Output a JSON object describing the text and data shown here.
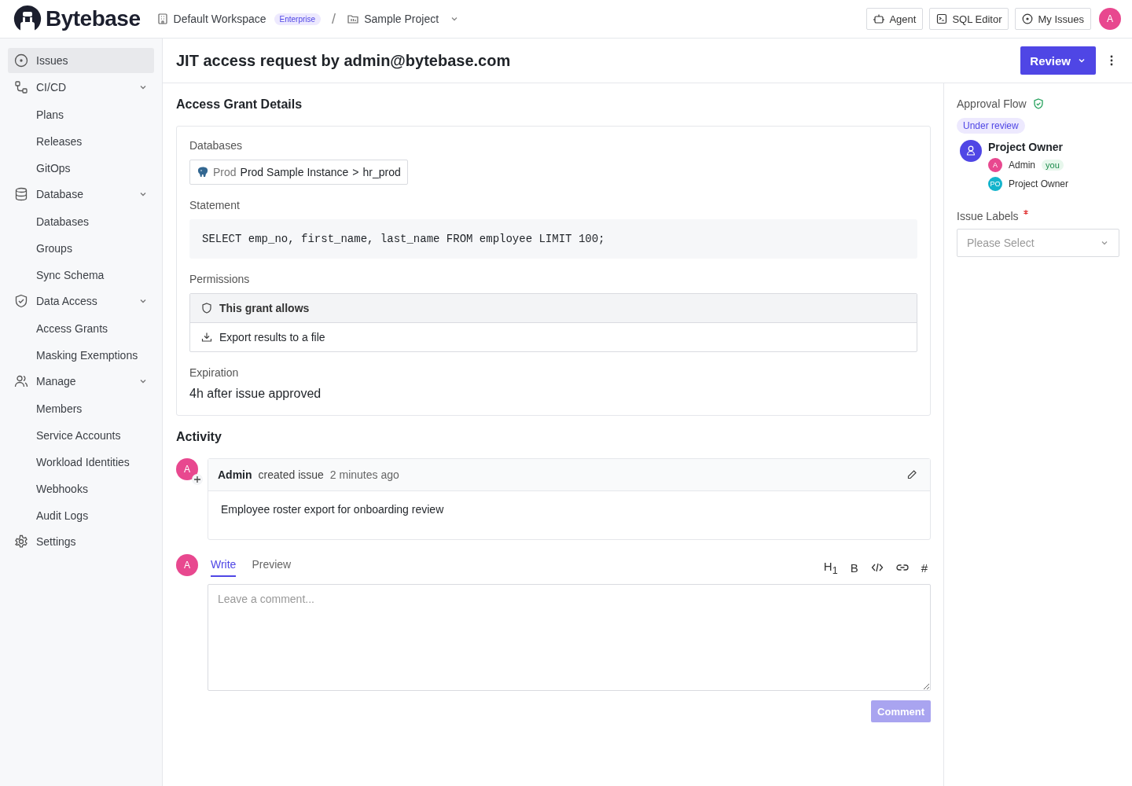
{
  "topbar": {
    "logo": "Bytebase",
    "workspace": "Default Workspace",
    "plan_badge": "Enterprise",
    "separator": "/",
    "project": "Sample Project",
    "buttons": [
      "Agent",
      "SQL Editor",
      "My Issues"
    ],
    "avatar": "A"
  },
  "sidebar": {
    "items": [
      {
        "label": "Issues",
        "selected": true
      },
      {
        "label": "CI/CD",
        "selected": false,
        "expanded": true,
        "children": [
          {
            "label": "Plans",
            "selected": false
          },
          {
            "label": "Releases",
            "selected": false
          },
          {
            "label": "GitOps",
            "selected": false
          }
        ]
      },
      {
        "label": "Database",
        "selected": false,
        "expanded": true,
        "children": [
          {
            "label": "Databases",
            "selected": false
          },
          {
            "label": "Groups",
            "selected": false
          },
          {
            "label": "Sync Schema",
            "selected": false
          }
        ]
      },
      {
        "label": "Data Access",
        "selected": false,
        "expanded": true,
        "children": [
          {
            "label": "Access Grants",
            "selected": false
          },
          {
            "label": "Masking Exemptions",
            "selected": false
          }
        ]
      },
      {
        "label": "Manage",
        "selected": false,
        "expanded": true,
        "children": [
          {
            "label": "Members",
            "selected": false
          },
          {
            "label": "Service Accounts",
            "selected": false
          },
          {
            "label": "Workload Identities",
            "selected": false
          },
          {
            "label": "Webhooks",
            "selected": false
          },
          {
            "label": "Audit Logs",
            "selected": false
          }
        ]
      },
      {
        "label": "Settings",
        "selected": false
      }
    ]
  },
  "issue": {
    "title": "JIT access request by admin@bytebase.com",
    "review_button": "Review"
  },
  "details": {
    "heading": "Access Grant Details",
    "databases_label": "Databases",
    "database": {
      "env": "Prod",
      "instance": "Prod Sample Instance",
      "separator": ">",
      "name": "hr_prod"
    },
    "statement_label": "Statement",
    "statement": "SELECT emp_no, first_name, last_name FROM employee LIMIT 100;",
    "permissions_label": "Permissions",
    "permissions_header": "This grant allows",
    "permissions": [
      "Export results to a file"
    ],
    "expiration_label": "Expiration",
    "expiration": "4h after issue approved"
  },
  "activity": {
    "heading": "Activity",
    "entries": [
      {
        "avatar": "A",
        "author": "Admin",
        "action": "created issue",
        "time": "2 minutes ago",
        "body": "Employee roster export for onboarding review"
      }
    ],
    "composer": {
      "avatar": "A",
      "tabs": [
        {
          "label": "Write",
          "selected": true
        },
        {
          "label": "Preview",
          "selected": false
        }
      ],
      "tools": [
        {
          "kind": "text",
          "label": "H$_{1}$"
        },
        {
          "kind": "text",
          "label": "B"
        },
        {
          "kind": "code"
        },
        {
          "kind": "link"
        },
        {
          "kind": "text",
          "label": "#"
        }
      ],
      "placeholder": "Leave a comment...",
      "button": "Comment",
      "button_disabled": true
    }
  },
  "approval": {
    "heading": "Approval Flow",
    "status": "Under review",
    "steps": [
      {
        "role": "Project Owner",
        "approvers": [
          {
            "initials": "A",
            "name": "Admin",
            "badge": "you",
            "color": "#e8488f"
          },
          {
            "initials": "PO",
            "name": "Project Owner",
            "color": "#14b4cc"
          }
        ]
      }
    ]
  },
  "labels": {
    "label": "Issue Labels",
    "required": true,
    "placeholder": "Please Select"
  }
}
